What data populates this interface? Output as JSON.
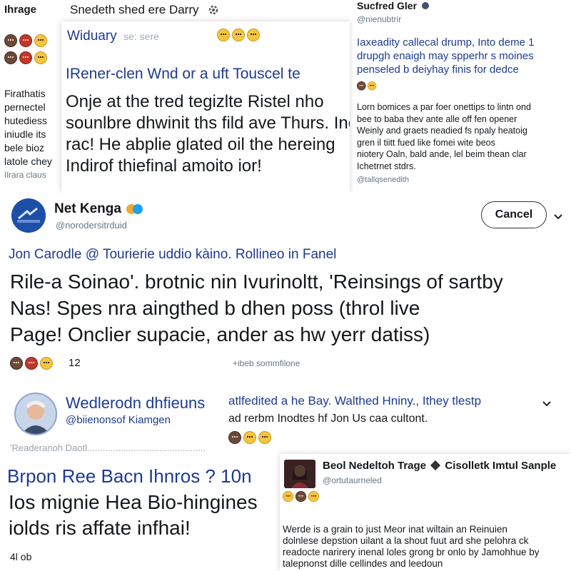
{
  "top_left": {
    "name": "Ihrage",
    "title": "Snedeth shed ere Darry",
    "side_lines": [
      "Firathatis",
      "pernectel",
      "hutediess",
      "iniudle its",
      "bele bioz",
      "latole chey",
      "Ilrara claus"
    ]
  },
  "top_center": {
    "header": "Widuary",
    "header_handle": "se: sere",
    "subtitle": "IRener-clen Wnd or a uft Touscel te",
    "body_lines": [
      "Onje at the tred tegizlte Ristel nho",
      "sounlbre dhwinit ths fild ave Thurs. Ine",
      "rac! He abplie glated oil the hereing",
      "Indirof thiefinal amoito ior!"
    ]
  },
  "top_right": {
    "name": "Sucfred Gler",
    "handle": "@nienubtrir",
    "lines_a": [
      "Iaxeadity callecal drump, Into deme 1",
      "drupgh enaigh may spperhr s moines",
      "penseled b deiyhay finis for dedce"
    ],
    "lines_b": [
      "Lorn bomices a par foer onettips to lintn ond",
      "bee to baba thev ante alle off fen opener",
      "Weinly and graets neadied fs npaly heatoig",
      "gren il tiitt fued like fomei wite beos",
      "niotery Oaln, bald ande, lel beim thean clar",
      "Ichetrnet stdrs."
    ],
    "footer_handle": "@tallqsenedith"
  },
  "main_post": {
    "name": "Net Kenga",
    "handle": "@norodersitrduid",
    "cancel_label": "Cancel",
    "subtitle": "Jon Carodle @ Tourierie uddio kàino. Rollineo in Fanel",
    "body_lines": [
      "Rile-a Soinao'. brotnic nin Ivurinoltt, 'Reinsings of sartby",
      "Nas! Spes nra aingthed b dhen poss (throl live",
      "Page! Onclier supacie, ander as hw yerr datiss)"
    ],
    "reaction_count": "12",
    "meta": "+ibeb sommfilone"
  },
  "profile_post": {
    "name": "Wedlerodn dhfieuns",
    "handle": "@biienonsof Kiamgen",
    "right_line1": "atlfedited a he Bay.  Walthed Hniny., Ithey tlestp",
    "right_line2": "ad rerbm Inodtes hf Jon Us caa cultont.",
    "faded_line": "'Readeranoh Daotl..............................................",
    "headline": "Brpon Ree Bacn Ihnros ? 10n",
    "body_lines": [
      "Ios mignie Hea Bio-hingines",
      "iolds ris affate infhai!"
    ],
    "footer": "4l ob"
  },
  "bottom_right": {
    "name": "Beol Nedeltoh Trage",
    "name_suffix": "Cisolletk Imtul Sanple",
    "handle": "@ortutaurneled",
    "body_lines": [
      "Werde is a grain to just Meor inat wiltain an Reinuien",
      "dolnlese depstion uilant a la shout fuut ard she pelohra ck",
      "readocte narirery inenal loles grong br onlo by Jamohhue by",
      "talepnonst dille cellindes and leedoun"
    ]
  },
  "colors": {
    "verified": "#1da1f2",
    "subtitle_blue": "#1d3b8f",
    "muted": "#657786",
    "emoji": "#f5c542"
  },
  "icons": [
    "gear-icon",
    "verified-badge-icon",
    "chevron-down-icon",
    "emoji-icon"
  ]
}
